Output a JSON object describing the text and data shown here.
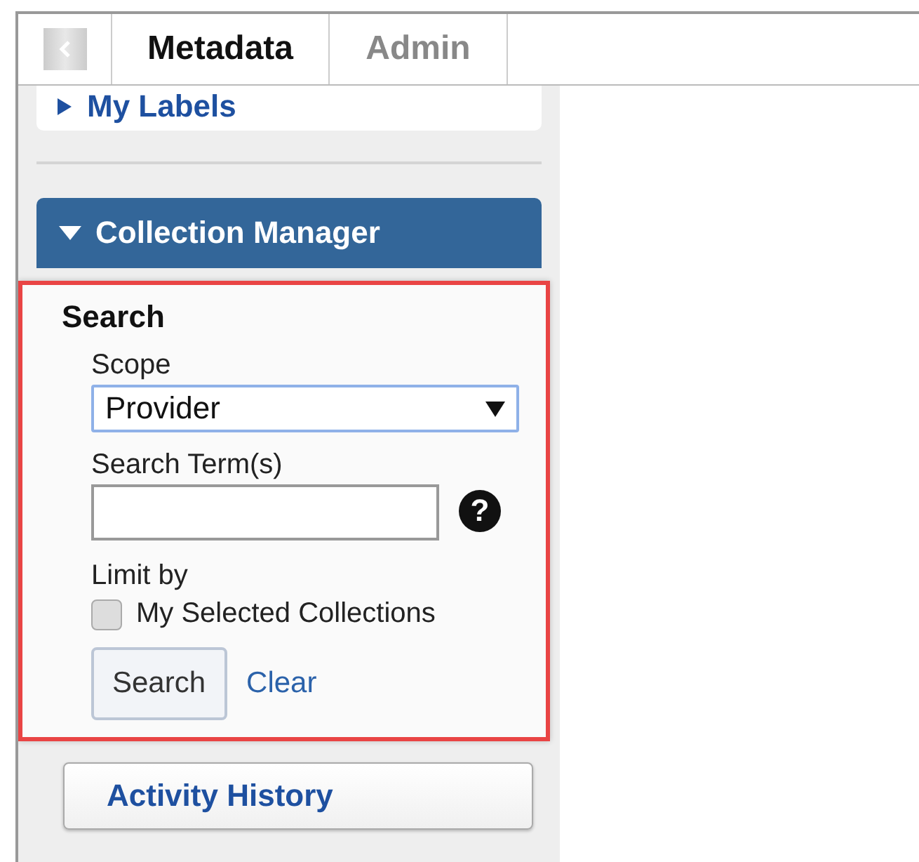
{
  "tabs": [
    {
      "label": "Metadata",
      "selected": true
    },
    {
      "label": "Admin",
      "selected": false
    }
  ],
  "sidebar": {
    "labels_section": {
      "title": "My Labels",
      "expanded": false
    },
    "collection_manager": {
      "title": "Collection Manager",
      "expanded": true,
      "search": {
        "heading": "Search",
        "scope_label": "Scope",
        "scope_value": "Provider",
        "terms_label": "Search Term(s)",
        "help": "?",
        "limit_label": "Limit by",
        "limit_option": {
          "label": "My Selected Collections",
          "checked": false
        },
        "search_button": "Search",
        "clear_link": "Clear"
      }
    },
    "activity_button": "Activity History"
  }
}
